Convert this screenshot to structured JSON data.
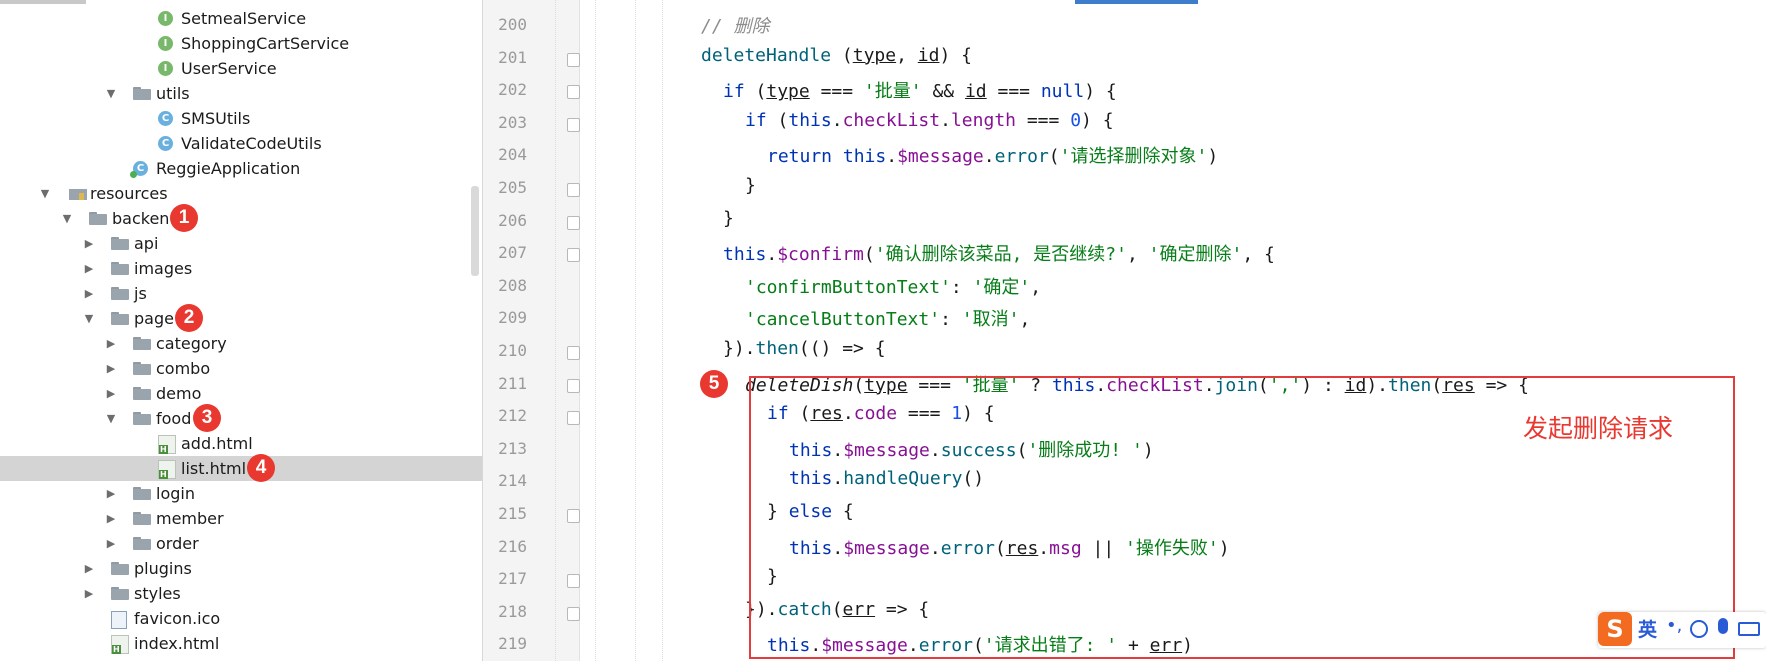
{
  "tree": {
    "items": [
      {
        "label": "SetmealService",
        "icon": "interface-icon",
        "depth": 4,
        "arrow": "",
        "badge": ""
      },
      {
        "label": "ShoppingCartService",
        "icon": "interface-icon",
        "depth": 4,
        "arrow": "",
        "badge": ""
      },
      {
        "label": "UserService",
        "icon": "interface-icon",
        "depth": 4,
        "arrow": "",
        "badge": ""
      },
      {
        "label": "utils",
        "icon": "folder-icon",
        "depth": 3,
        "arrow": "expanded",
        "badge": ""
      },
      {
        "label": "SMSUtils",
        "icon": "class-icon",
        "depth": 4,
        "arrow": "",
        "badge": ""
      },
      {
        "label": "ValidateCodeUtils",
        "icon": "class-icon",
        "depth": 4,
        "arrow": "",
        "badge": ""
      },
      {
        "label": "ReggieApplication",
        "icon": "spring-app-icon",
        "depth": 3,
        "arrow": "",
        "badge": ""
      },
      {
        "label": "resources",
        "icon": "resources-folder-icon",
        "depth": 0,
        "arrow": "expanded",
        "badge": ""
      },
      {
        "label": "backend",
        "icon": "folder-icon",
        "depth": 1,
        "arrow": "expanded",
        "badge": "1"
      },
      {
        "label": "api",
        "icon": "folder-icon",
        "depth": 2,
        "arrow": "collapsed",
        "badge": ""
      },
      {
        "label": "images",
        "icon": "folder-icon",
        "depth": 2,
        "arrow": "collapsed",
        "badge": ""
      },
      {
        "label": "js",
        "icon": "folder-icon",
        "depth": 2,
        "arrow": "collapsed",
        "badge": ""
      },
      {
        "label": "page",
        "icon": "folder-icon",
        "depth": 2,
        "arrow": "expanded",
        "badge": "2"
      },
      {
        "label": "category",
        "icon": "folder-icon",
        "depth": 3,
        "arrow": "collapsed",
        "badge": ""
      },
      {
        "label": "combo",
        "icon": "folder-icon",
        "depth": 3,
        "arrow": "collapsed",
        "badge": ""
      },
      {
        "label": "demo",
        "icon": "folder-icon",
        "depth": 3,
        "arrow": "collapsed",
        "badge": ""
      },
      {
        "label": "food",
        "icon": "folder-icon",
        "depth": 3,
        "arrow": "expanded",
        "badge": "3"
      },
      {
        "label": "add.html",
        "icon": "html-file-icon",
        "depth": 4,
        "arrow": "",
        "badge": ""
      },
      {
        "label": "list.html",
        "icon": "html-file-icon",
        "depth": 4,
        "arrow": "",
        "badge": "4",
        "selected": true
      },
      {
        "label": "login",
        "icon": "folder-icon",
        "depth": 3,
        "arrow": "collapsed",
        "badge": ""
      },
      {
        "label": "member",
        "icon": "folder-icon",
        "depth": 3,
        "arrow": "collapsed",
        "badge": ""
      },
      {
        "label": "order",
        "icon": "folder-icon",
        "depth": 3,
        "arrow": "collapsed",
        "badge": ""
      },
      {
        "label": "plugins",
        "icon": "folder-icon",
        "depth": 2,
        "arrow": "collapsed",
        "badge": ""
      },
      {
        "label": "styles",
        "icon": "folder-icon",
        "depth": 2,
        "arrow": "collapsed",
        "badge": ""
      },
      {
        "label": "favicon.ico",
        "icon": "ico-file-icon",
        "depth": 2,
        "arrow": "",
        "badge": ""
      },
      {
        "label": "index.html",
        "icon": "html-file-icon",
        "depth": 2,
        "arrow": "",
        "badge": ""
      }
    ]
  },
  "editor": {
    "first_line": 200,
    "lines": [
      {
        "indent": 0,
        "tokens": [
          [
            "cm",
            "// 删除"
          ]
        ]
      },
      {
        "indent": 0,
        "tokens": [
          [
            "fnd",
            "deleteHandle"
          ],
          [
            "plain",
            " ("
          ],
          [
            "param",
            "type"
          ],
          [
            "plain",
            ", "
          ],
          [
            "param",
            "id"
          ],
          [
            "plain",
            ") {"
          ]
        ]
      },
      {
        "indent": 1,
        "tokens": [
          [
            "kw",
            "if"
          ],
          [
            "plain",
            " ("
          ],
          [
            "param",
            "type"
          ],
          [
            "plain",
            " === "
          ],
          [
            "str",
            "'批量'"
          ],
          [
            "plain",
            " && "
          ],
          [
            "param",
            "id"
          ],
          [
            "plain",
            " === "
          ],
          [
            "kw",
            "null"
          ],
          [
            "plain",
            ") {"
          ]
        ]
      },
      {
        "indent": 2,
        "tokens": [
          [
            "kw",
            "if"
          ],
          [
            "plain",
            " ("
          ],
          [
            "kw",
            "this"
          ],
          [
            "plain",
            "."
          ],
          [
            "prop",
            "checkList"
          ],
          [
            "plain",
            "."
          ],
          [
            "prop",
            "length"
          ],
          [
            "plain",
            " === "
          ],
          [
            "num",
            "0"
          ],
          [
            "plain",
            ") {"
          ]
        ]
      },
      {
        "indent": 3,
        "tokens": [
          [
            "kw",
            "return this"
          ],
          [
            "plain",
            "."
          ],
          [
            "prop",
            "$message"
          ],
          [
            "plain",
            "."
          ],
          [
            "fn",
            "error"
          ],
          [
            "plain",
            "("
          ],
          [
            "str",
            "'请选择删除对象'"
          ],
          [
            "plain",
            ")"
          ]
        ]
      },
      {
        "indent": 2,
        "tokens": [
          [
            "plain",
            "}"
          ]
        ]
      },
      {
        "indent": 1,
        "tokens": [
          [
            "plain",
            "}"
          ]
        ]
      },
      {
        "indent": 1,
        "tokens": [
          [
            "kw",
            "this"
          ],
          [
            "plain",
            "."
          ],
          [
            "prop",
            "$confirm"
          ],
          [
            "plain",
            "("
          ],
          [
            "str",
            "'确认删除该菜品, 是否继续?'"
          ],
          [
            "plain",
            ", "
          ],
          [
            "str",
            "'确定删除'"
          ],
          [
            "plain",
            ", {"
          ]
        ]
      },
      {
        "indent": 2,
        "tokens": [
          [
            "str",
            "'confirmButtonText'"
          ],
          [
            "plain",
            ": "
          ],
          [
            "str",
            "'确定'"
          ],
          [
            "plain",
            ","
          ]
        ]
      },
      {
        "indent": 2,
        "tokens": [
          [
            "str",
            "'cancelButtonText'"
          ],
          [
            "plain",
            ": "
          ],
          [
            "str",
            "'取消'"
          ],
          [
            "plain",
            ","
          ]
        ]
      },
      {
        "indent": 1,
        "tokens": [
          [
            "plain",
            "})."
          ],
          [
            "fn",
            "then"
          ],
          [
            "plain",
            "(() => {"
          ]
        ]
      },
      {
        "indent": 2,
        "tokens": [
          [
            "ital",
            "deleteDish"
          ],
          [
            "plain",
            "("
          ],
          [
            "param",
            "type"
          ],
          [
            "plain",
            " === "
          ],
          [
            "str",
            "'批量'"
          ],
          [
            "plain",
            " ? "
          ],
          [
            "kw",
            "this"
          ],
          [
            "plain",
            "."
          ],
          [
            "prop",
            "checkList"
          ],
          [
            "plain",
            "."
          ],
          [
            "fn",
            "join"
          ],
          [
            "plain",
            "("
          ],
          [
            "str",
            "','"
          ],
          [
            "plain",
            ") : "
          ],
          [
            "param",
            "id"
          ],
          [
            "plain",
            ")."
          ],
          [
            "fn",
            "then"
          ],
          [
            "plain",
            "("
          ],
          [
            "param",
            "res"
          ],
          [
            "plain",
            " => {"
          ]
        ]
      },
      {
        "indent": 3,
        "tokens": [
          [
            "kw",
            "if"
          ],
          [
            "plain",
            " ("
          ],
          [
            "param",
            "res"
          ],
          [
            "plain",
            "."
          ],
          [
            "prop",
            "code"
          ],
          [
            "plain",
            " === "
          ],
          [
            "num",
            "1"
          ],
          [
            "plain",
            ") {"
          ]
        ]
      },
      {
        "indent": 4,
        "tokens": [
          [
            "kw",
            "this"
          ],
          [
            "plain",
            "."
          ],
          [
            "prop",
            "$message"
          ],
          [
            "plain",
            "."
          ],
          [
            "fn",
            "success"
          ],
          [
            "plain",
            "("
          ],
          [
            "str",
            "'删除成功! '"
          ],
          [
            "plain",
            ")"
          ]
        ]
      },
      {
        "indent": 4,
        "tokens": [
          [
            "kw",
            "this"
          ],
          [
            "plain",
            "."
          ],
          [
            "fn",
            "handleQuery"
          ],
          [
            "plain",
            "()"
          ]
        ]
      },
      {
        "indent": 3,
        "tokens": [
          [
            "plain",
            "} "
          ],
          [
            "kw",
            "else"
          ],
          [
            "plain",
            " {"
          ]
        ]
      },
      {
        "indent": 4,
        "tokens": [
          [
            "kw",
            "this"
          ],
          [
            "plain",
            "."
          ],
          [
            "prop",
            "$message"
          ],
          [
            "plain",
            "."
          ],
          [
            "fn",
            "error"
          ],
          [
            "plain",
            "("
          ],
          [
            "param",
            "res"
          ],
          [
            "plain",
            "."
          ],
          [
            "prop",
            "msg"
          ],
          [
            "plain",
            " || "
          ],
          [
            "str",
            "'操作失败'"
          ],
          [
            "plain",
            ")"
          ]
        ]
      },
      {
        "indent": 3,
        "tokens": [
          [
            "plain",
            "}"
          ]
        ]
      },
      {
        "indent": 2,
        "tokens": [
          [
            "plain",
            "})."
          ],
          [
            "fn",
            "catch"
          ],
          [
            "plain",
            "("
          ],
          [
            "param",
            "err"
          ],
          [
            "plain",
            " => {"
          ]
        ]
      },
      {
        "indent": 3,
        "tokens": [
          [
            "kw",
            "this"
          ],
          [
            "plain",
            "."
          ],
          [
            "prop",
            "$message"
          ],
          [
            "plain",
            "."
          ],
          [
            "fn",
            "error"
          ],
          [
            "plain",
            "("
          ],
          [
            "str",
            "'请求出错了: '"
          ],
          [
            "plain",
            " + "
          ],
          [
            "param",
            "err"
          ],
          [
            "plain",
            ")"
          ]
        ]
      }
    ],
    "fold_lines": [
      201,
      202,
      203,
      205,
      206,
      207,
      210,
      211,
      212,
      215,
      217,
      218
    ],
    "highlight_badge": "5",
    "annotation": "发起删除请求"
  },
  "ime": {
    "logo": "S",
    "mode": "英",
    "punct": "•,"
  }
}
